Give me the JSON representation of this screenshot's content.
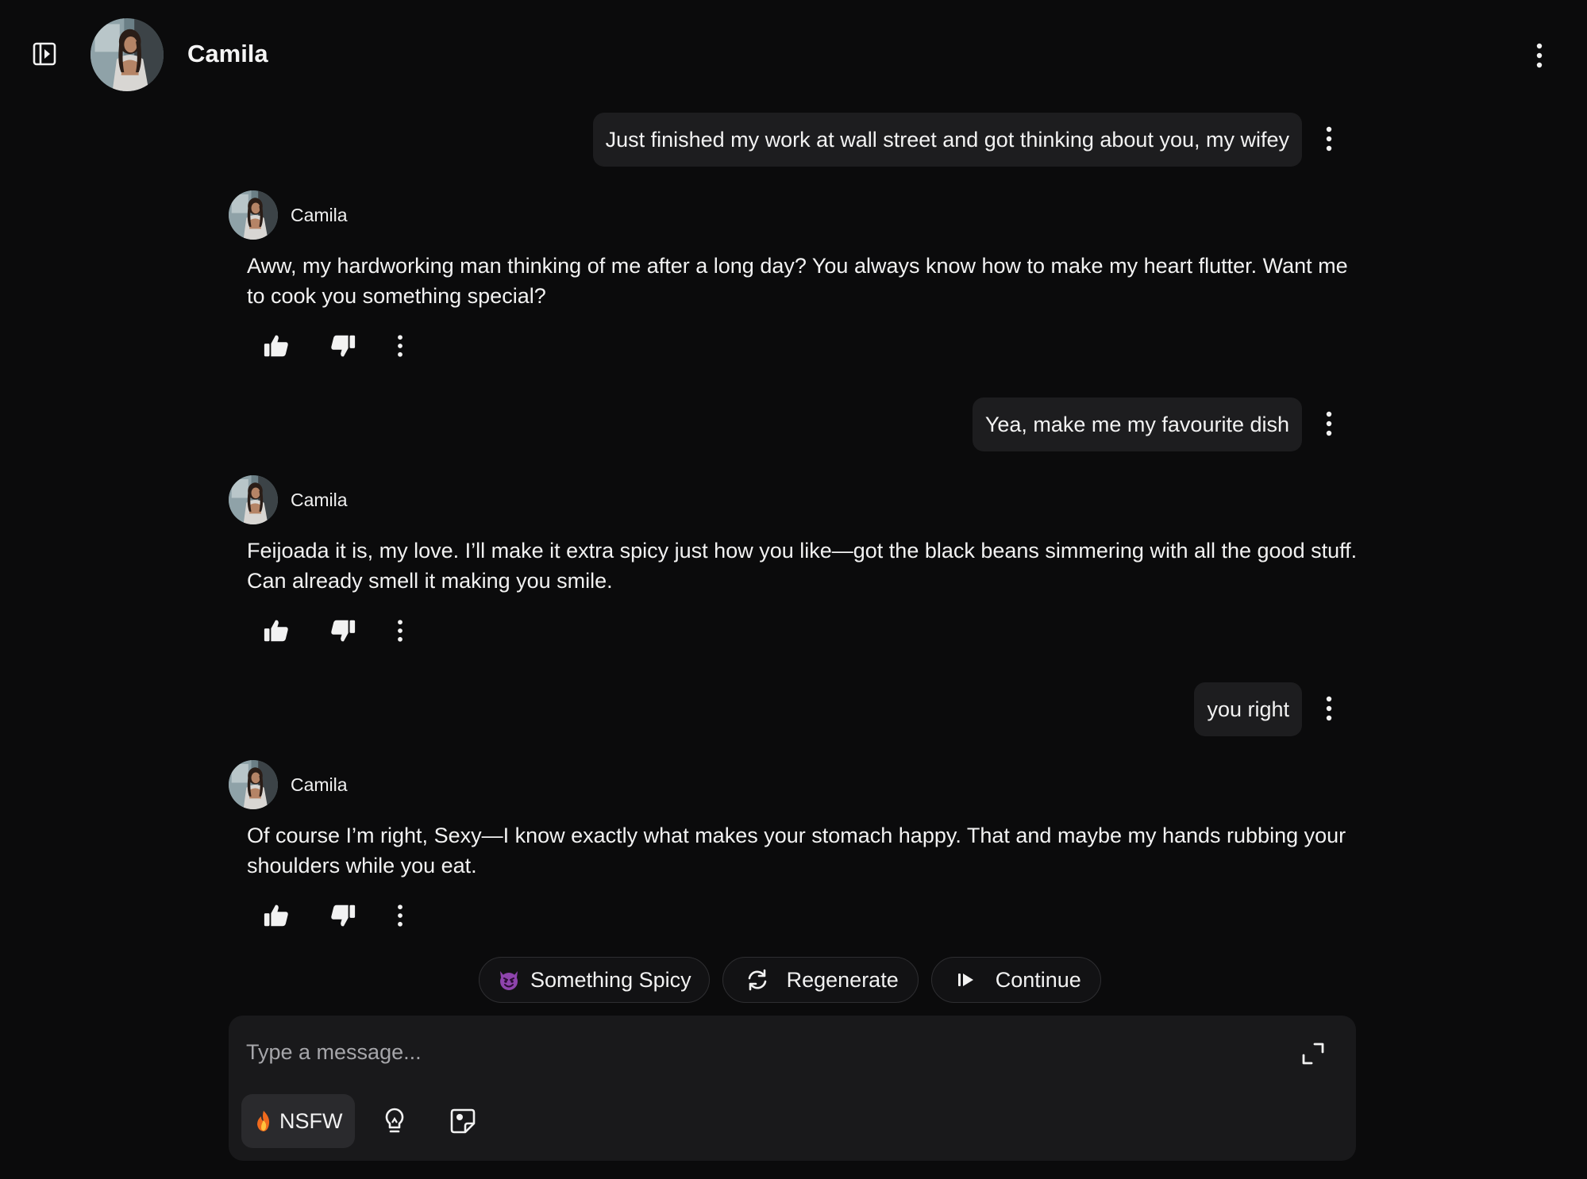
{
  "header": {
    "name": "Camila",
    "icons": {
      "sidebar": "sidebar-toggle-icon",
      "menu": "more-vertical-icon"
    }
  },
  "messages": [
    {
      "role": "user",
      "text": "Just finished my work at wall street and got thinking about you, my wifey"
    },
    {
      "role": "assistant",
      "name": "Camila",
      "text": "Aww, my hardworking man thinking of me after a long day? You always know how to make my heart flutter. Want me to cook you something special?"
    },
    {
      "role": "user",
      "text": "Yea, make me my favourite dish"
    },
    {
      "role": "assistant",
      "name": "Camila",
      "text": "Feijoada it is, my love. I’ll make it extra spicy just how you like—got the black beans simmering with all the good stuff. Can already smell it making you smile."
    },
    {
      "role": "user",
      "text": "you right"
    },
    {
      "role": "assistant",
      "name": "Camila",
      "text": "Of course I’m right, Sexy—I know exactly what makes your stomach happy. That and maybe my hands rubbing your shoulders while you eat."
    }
  ],
  "message_actions": {
    "like": "thumbs-up-icon",
    "dislike": "thumbs-down-icon",
    "more": "more-vertical-icon"
  },
  "suggestions": [
    {
      "label": "Something Spicy",
      "icon": "devil-emoji-icon"
    },
    {
      "label": "Regenerate",
      "icon": "refresh-icon"
    },
    {
      "label": "Continue",
      "icon": "skip-forward-icon"
    }
  ],
  "composer": {
    "placeholder": "Type a message...",
    "nsfw_label": "NSFW",
    "icons": {
      "expand": "expand-icon",
      "flame": "flame-icon",
      "bulb": "lightbulb-icon",
      "sticker": "sticker-icon"
    }
  },
  "colors": {
    "background": "#0b0b0c",
    "bubble": "#1d1d1f",
    "composer": "#19191b",
    "accent_purple": "#8e44ad"
  }
}
